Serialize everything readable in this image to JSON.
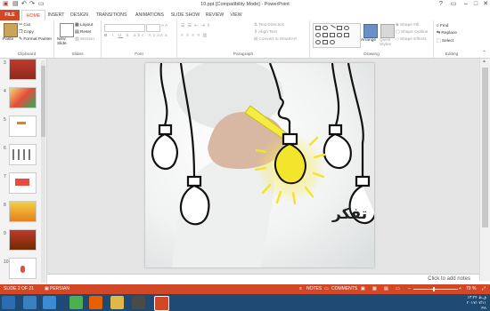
{
  "app": {
    "title": "10.ppt [Compatibility Mode] - PowerPoint",
    "account_tag": "?",
    "window_controls": [
      "?",
      "▭",
      "–",
      "□",
      "✕"
    ]
  },
  "tabs": [
    "FILE",
    "HOME",
    "INSERT",
    "DESIGN",
    "TRANSITIONS",
    "ANIMATIONS",
    "SLIDE SHOW",
    "REVIEW",
    "VIEW"
  ],
  "ribbon": {
    "clipboard": {
      "paste": "Paste",
      "cut": "Cut",
      "copy": "Copy",
      "format_painter": "Format Painter",
      "label": "Clipboard"
    },
    "slides": {
      "new_slide": "New Slide",
      "layout": "Layout",
      "reset": "Reset",
      "section": "Section",
      "label": "Slides"
    },
    "font": {
      "label": "Font"
    },
    "paragraph": {
      "text_direction": "Text Direction",
      "align_text": "Align Text",
      "convert_smartart": "Convert to SmartArt",
      "label": "Paragraph"
    },
    "drawing": {
      "arrange": "Arrange",
      "quick_styles": "Quick Styles",
      "shape_fill": "Shape Fill",
      "shape_outline": "Shape Outline",
      "shape_effects": "Shape Effects",
      "label": "Drawing"
    },
    "editing": {
      "find": "Find",
      "replace": "Replace",
      "select": "Select",
      "label": "Editing"
    }
  },
  "thumbnails": [
    "3",
    "4",
    "5",
    "6",
    "7",
    "8",
    "9",
    "10"
  ],
  "slide": {
    "caption": "تفكر"
  },
  "notes": {
    "placeholder": "Click to add notes"
  },
  "status": {
    "slide_counter": "SLIDE 2 OF 21",
    "language": "PERSIAN",
    "notes": "NOTES",
    "comments": "COMMENTS",
    "zoom": "70 %"
  },
  "tray": {
    "time": "۱۳:۲۴ ق.ظ",
    "date": "۲۰۱۷/۰۷/۱۱",
    "lang": "FA"
  },
  "colors": {
    "accent": "#d24726",
    "taskbar": "#1f4a73",
    "bulb_glow": "#f3e42c"
  }
}
